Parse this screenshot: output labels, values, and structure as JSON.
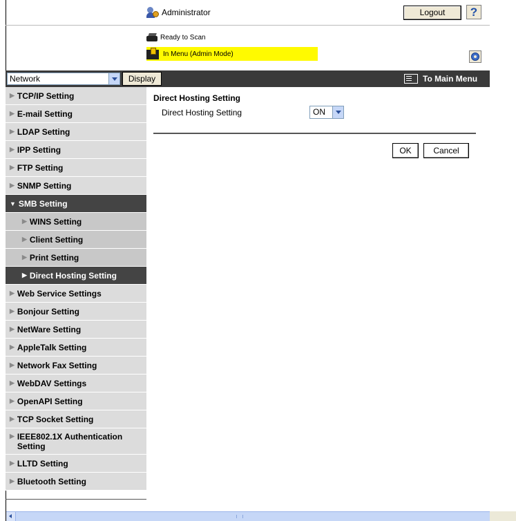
{
  "header": {
    "user": "Administrator",
    "logout_label": "Logout",
    "help_label": "?",
    "status_ready": "Ready to Scan",
    "status_mode": "In Menu (Admin Mode)",
    "highlight_color": "#fffa00"
  },
  "toolbar": {
    "category_selected": "Network",
    "display_label": "Display",
    "to_main_menu_label": "To Main Menu"
  },
  "sidebar": {
    "items": [
      {
        "label": "TCP/IP Setting"
      },
      {
        "label": "E-mail Setting"
      },
      {
        "label": "LDAP Setting"
      },
      {
        "label": "IPP Setting"
      },
      {
        "label": "FTP Setting"
      },
      {
        "label": "SNMP Setting"
      },
      {
        "label": "SMB Setting"
      },
      {
        "label": "WINS Setting"
      },
      {
        "label": "Client Setting"
      },
      {
        "label": "Print Setting"
      },
      {
        "label": "Direct Hosting Setting"
      },
      {
        "label": "Web Service Settings"
      },
      {
        "label": "Bonjour Setting"
      },
      {
        "label": "NetWare Setting"
      },
      {
        "label": "AppleTalk Setting"
      },
      {
        "label": "Network Fax Setting"
      },
      {
        "label": "WebDAV Settings"
      },
      {
        "label": "OpenAPI Setting"
      },
      {
        "label": "TCP Socket Setting"
      },
      {
        "label": "IEEE802.1X Authentication Setting"
      },
      {
        "label": "LLTD Setting"
      },
      {
        "label": "Bluetooth Setting"
      }
    ]
  },
  "main": {
    "title": "Direct Hosting Setting",
    "field_label": "Direct Hosting Setting",
    "field_value": "ON",
    "ok_label": "OK",
    "cancel_label": "Cancel"
  }
}
